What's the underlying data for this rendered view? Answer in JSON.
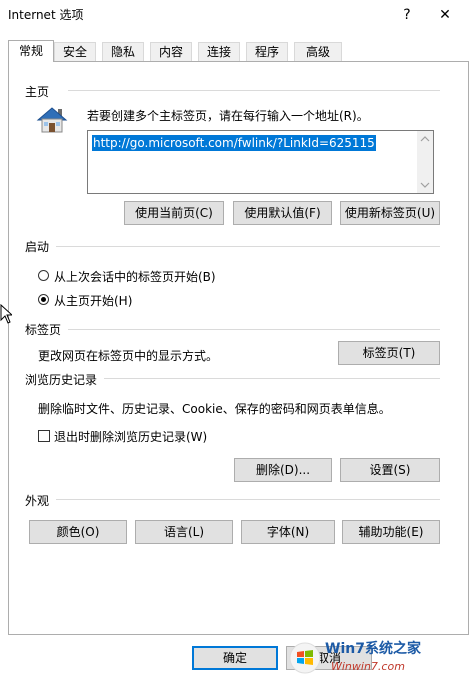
{
  "window": {
    "title": "Internet 选项",
    "help": "?",
    "close": "✕"
  },
  "tabs": [
    "常规",
    "安全",
    "隐私",
    "内容",
    "连接",
    "程序",
    "高级"
  ],
  "home": {
    "section": "主页",
    "instruction": "若要创建多个主标签页，请在每行输入一个地址(R)。",
    "url": "http://go.microsoft.com/fwlink/?LinkId=625115",
    "btn_current": "使用当前页(C)",
    "btn_default": "使用默认值(F)",
    "btn_newtab": "使用新标签页(U)"
  },
  "startup": {
    "section": "启动",
    "opt_last": "从上次会话中的标签页开始(B)",
    "opt_home": "从主页开始(H)"
  },
  "tabsec": {
    "section": "标签页",
    "desc": "更改网页在标签页中的显示方式。",
    "btn": "标签页(T)"
  },
  "history": {
    "section": "浏览历史记录",
    "desc": "删除临时文件、历史记录、Cookie、保存的密码和网页表单信息。",
    "check_label": "退出时删除浏览历史记录(W)",
    "btn_delete": "删除(D)...",
    "btn_settings": "设置(S)"
  },
  "appearance": {
    "section": "外观",
    "btn_colors": "颜色(O)",
    "btn_languages": "语言(L)",
    "btn_fonts": "字体(N)",
    "btn_access": "辅助功能(E)"
  },
  "footer": {
    "ok": "确定",
    "cancel": "取消"
  },
  "watermark": {
    "brand": "Win7系统之家",
    "site": "Winwin7.com"
  }
}
